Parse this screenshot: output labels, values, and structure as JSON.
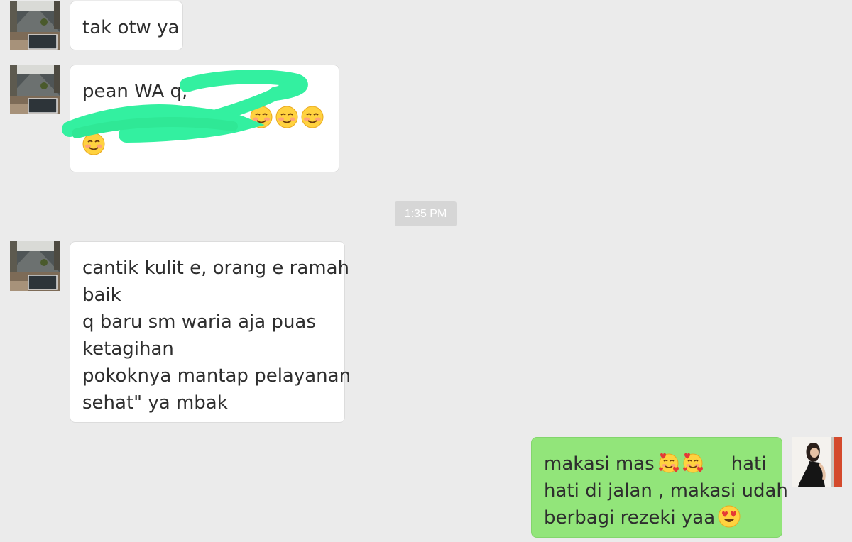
{
  "chat": {
    "messages": [
      {
        "id": "m1",
        "sender": "other",
        "lines": [
          "tak otw ya"
        ]
      },
      {
        "id": "m2",
        "sender": "other",
        "lines": [
          "pean WA q,"
        ],
        "emoji": [
          "smiling-blush-emoji",
          "smiling-blush-emoji",
          "smiling-blush-emoji",
          "smiling-blush-emoji"
        ]
      },
      {
        "id": "m3",
        "sender": "other",
        "lines": [
          "cantik kulit e, orang e ramah",
          "baik",
          "q baru sm waria aja puas",
          "ketagihan",
          "pokoknya mantap pelayanan",
          "sehat\" ya mbak"
        ]
      },
      {
        "id": "m4",
        "sender": "me",
        "lines": [
          "makasi mas",
          "hati",
          "hati di jalan , makasi udah",
          "berbagi rezeki yaa"
        ],
        "emoji": [
          "smiling-hearts-emoji",
          "smiling-hearts-emoji",
          "heart-eyes-emoji"
        ]
      }
    ],
    "timestamp": "1:35 PM"
  },
  "colors": {
    "background": "#ebebeb",
    "incoming_bubble": "#ffffff",
    "outgoing_bubble": "#92e57a",
    "timestamp_chip": "#d6d6d6",
    "redaction_marker": "#33f0a0"
  }
}
